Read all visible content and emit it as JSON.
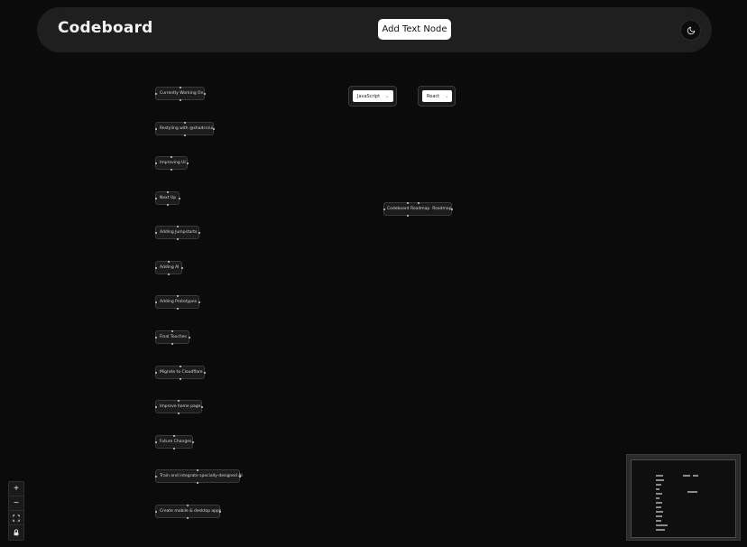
{
  "header": {
    "brand": "Codeboard",
    "add_button_label": "Add Text Node",
    "theme_icon": "moon-icon"
  },
  "nodes": [
    {
      "label": "Currently Working On"
    },
    {
      "label": "Restyling with @shadcn/ui"
    },
    {
      "label": "Improving UI"
    },
    {
      "label": "Next Up"
    },
    {
      "label": "Adding Jumpstarts"
    },
    {
      "label": "Adding AI"
    },
    {
      "label": "Adding Prototypes"
    },
    {
      "label": "Final Touches"
    },
    {
      "label": "Migrate to Cloudflare"
    },
    {
      "label": "Improve home page"
    },
    {
      "label": "Future Changes"
    },
    {
      "label": "Train and integrate specially-designed AI"
    },
    {
      "label": "Create mobile & desktop apps"
    },
    {
      "label": "Codeboard Roadmap"
    },
    {
      "label": "Roadmap"
    }
  ],
  "selects": [
    {
      "value": "JavaScript"
    },
    {
      "value": "React"
    }
  ],
  "controls": {
    "zoom_in_icon": "plus-icon",
    "zoom_out_icon": "minus-icon",
    "fit_view_icon": "fit-view-icon",
    "lock_icon": "lock-icon"
  },
  "colors": {
    "background": "#0b0b0b",
    "header": "#1f1f1f",
    "node": "#1c1c1c",
    "button": "#ffffff"
  }
}
